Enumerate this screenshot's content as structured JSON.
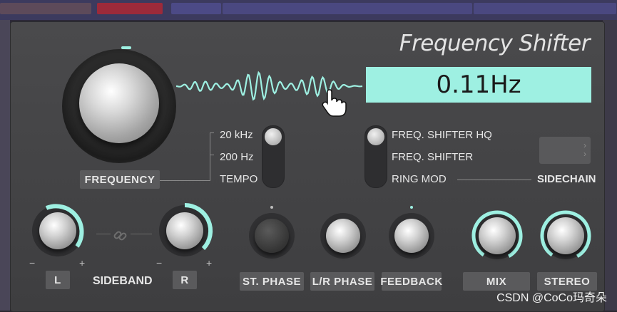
{
  "plugin": {
    "title": "Frequency Shifter",
    "display_value": "0.11Hz",
    "frequency_label": "FREQUENCY"
  },
  "range_switch": {
    "options": [
      "20 kHz",
      "200 Hz",
      "TEMPO"
    ],
    "selected": "20 kHz"
  },
  "mode_switch": {
    "options": [
      "FREQ. SHIFTER HQ",
      "FREQ. SHIFTER",
      "RING MOD"
    ],
    "selected": "FREQ. SHIFTER HQ"
  },
  "sidechain": {
    "label": "SIDECHAIN"
  },
  "sideband": {
    "label": "SIDEBAND",
    "left_label": "L",
    "right_label": "R",
    "minus": "−",
    "plus": "+"
  },
  "knobs": {
    "st_phase": "ST. PHASE",
    "lr_phase": "L/R PHASE",
    "feedback": "FEEDBACK",
    "mix": "MIX",
    "stereo": "STEREO"
  },
  "watermark": "CSDN @CoCo玛奇朵",
  "colors": {
    "accent": "#9ef0e2",
    "panel": "#444446",
    "label_bg": "#5a5a5c"
  }
}
